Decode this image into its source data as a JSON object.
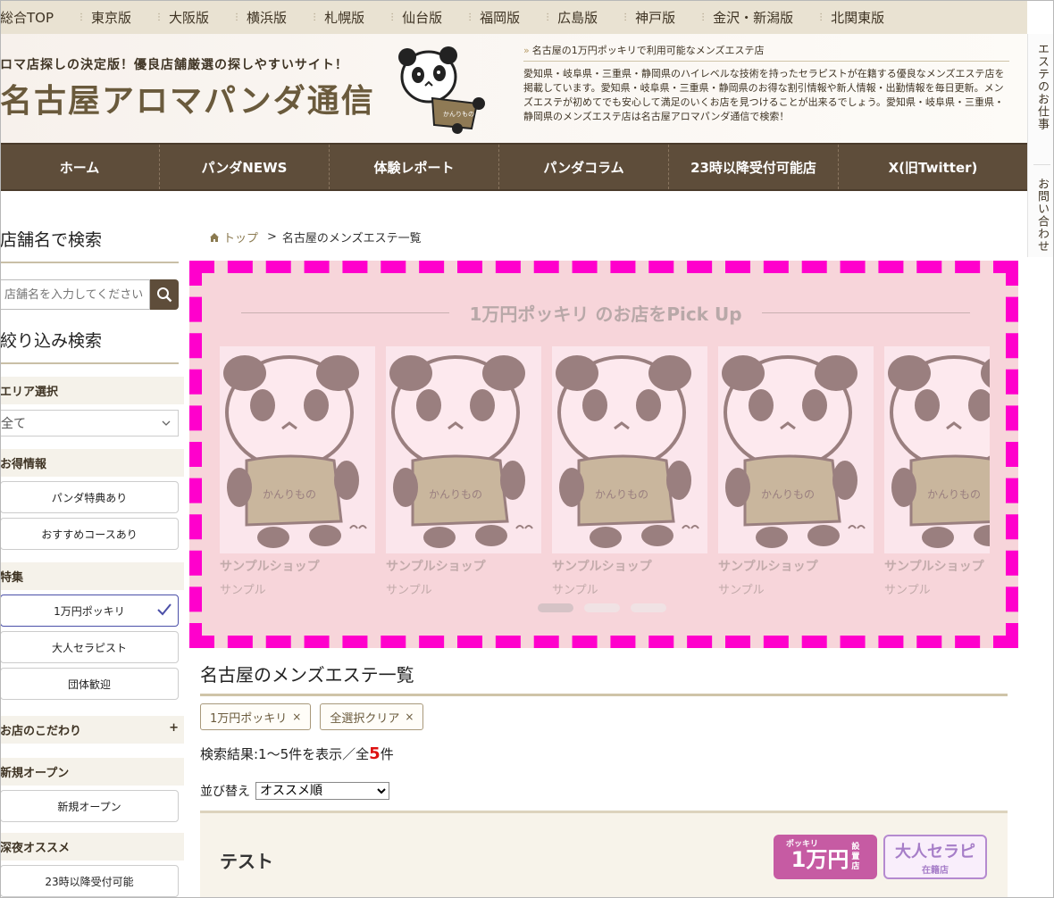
{
  "region_nav": [
    "総合TOP",
    "東京版",
    "大阪版",
    "横浜版",
    "札幌版",
    "仙台版",
    "福岡版",
    "広島版",
    "神戸版",
    "金沢・新潟版",
    "北関東版"
  ],
  "header": {
    "tagline": "ロマ店探しの決定版！優良店舗厳選の探しやすいサイト！",
    "site_title": "名古屋アロマパンダ通信",
    "logo_text": "かんりもの",
    "headline": "名古屋の1万円ポッキリで利用可能なメンズエステ店",
    "description": "愛知県・岐阜県・三重県・静岡県のハイレベルな技術を持ったセラピストが在籍する優良なメンズエステ店を掲載しています。愛知県・岐阜県・三重県・静岡県のお得な割引情報や新人情報・出勤情報を毎日更新。メンズエステが初めてでも安心して満足のいくお店を見つけることが出来るでしょう。愛知県・岐阜県・三重県・静岡県のメンズエステ店は名古屋アロマパンダ通信で検索！"
  },
  "main_nav": [
    "ホーム",
    "パンダNEWS",
    "体験レポート",
    "パンダコラム",
    "23時以降受付可能店",
    "X(旧Twitter)"
  ],
  "side_tabs": [
    "エステのお仕事",
    "お問い合わせ"
  ],
  "sidebar": {
    "search_heading": "店舗名で検索",
    "search_placeholder": "店舗名を入力してください",
    "filter_heading": "絞り込み検索",
    "area_label": "エリア選択",
    "area_value": "全て",
    "deals_label": "お得情報",
    "deals": [
      "パンダ特典あり",
      "おすすめコースあり"
    ],
    "feature_label": "特集",
    "features": [
      "1万円ポッキリ",
      "大人セラピスト",
      "団体歓迎"
    ],
    "kodawari_label": "お店のこだわり",
    "kodawari_toggle": "+",
    "new_label": "新規オープン",
    "new_button": "新規オープン",
    "late_label": "深夜オススメ",
    "late_button": "23時以降受付可能"
  },
  "breadcrumb": {
    "top": "トップ",
    "sep": ">",
    "current": "名古屋のメンズエステ一覧"
  },
  "pickup": {
    "title": "1万円ポッキリ のお店をPick Up",
    "cards": [
      {
        "name": "サンプルショップ",
        "sub": "サンプル",
        "label": "かんりもの"
      },
      {
        "name": "サンプルショップ",
        "sub": "サンプル",
        "label": "かんりもの"
      },
      {
        "name": "サンプルショップ",
        "sub": "サンプル",
        "label": "かんりもの"
      },
      {
        "name": "サンプルショップ",
        "sub": "サンプル",
        "label": "かんりもの"
      },
      {
        "name": "サンプルショップ",
        "sub": "サンプル",
        "label": "かんりもの"
      }
    ],
    "dots": 3,
    "active_dot": 0
  },
  "list": {
    "title": "名古屋のメンズエステ一覧",
    "chips": [
      "1万円ポッキリ",
      "全選択クリア"
    ],
    "chip_close": "×",
    "result_prefix": "検索結果:1〜5件を表示／全",
    "result_total": "5",
    "result_suffix": "件",
    "sort_label": "並び替え",
    "sort_value": "オススメ順"
  },
  "shop": {
    "name": "テスト",
    "badge1_top": "ポッキリ",
    "badge1_big": "1万円",
    "badge1_small": [
      "設",
      "置",
      "店"
    ],
    "badge2_big": "大人セラピ",
    "badge2_small": "在籍店"
  },
  "colors": {
    "nav_brown": "#5e4d3a",
    "highlight_border": "#ff00cc",
    "pickup_bg": "#f7d5da",
    "badge_pink": "#c65ba3",
    "badge_purple": "#b58ad0",
    "result_red": "#dd1111"
  }
}
